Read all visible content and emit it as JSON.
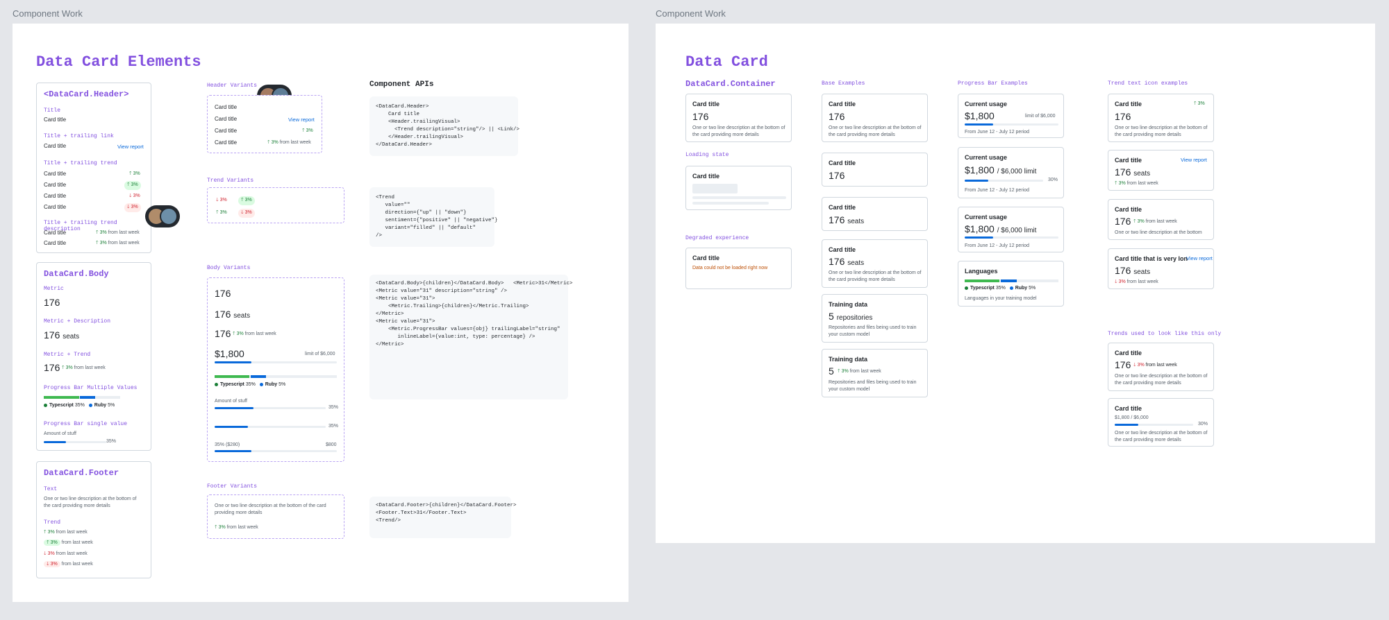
{
  "frames": {
    "left_label": "Component Work",
    "right_label": "Component Work"
  },
  "left": {
    "title": "Data Card Elements",
    "header_panel": {
      "title": "<DataCard.Header>",
      "s1": "Title",
      "s1_card": "Card title",
      "s2": "Title + trailing link",
      "s2_card": "Card title",
      "s2_link": "View report",
      "s3": "Title + trailing trend",
      "s3_rows": [
        {
          "label": "Card title",
          "trend": "3%"
        },
        {
          "label": "Card title",
          "trend": "3%"
        },
        {
          "label": "Card title",
          "trend": "3%"
        },
        {
          "label": "Card title",
          "trend": "3%"
        }
      ],
      "s4": "Title + trailing trend description",
      "s4_rows": [
        {
          "label": "Card title",
          "trend": "3%",
          "desc": "from last week"
        },
        {
          "label": "Card title",
          "trend": "3%",
          "desc": "from last week"
        }
      ]
    },
    "body_panel": {
      "title": "DataCard.Body",
      "s1": "Metric",
      "s1_value": "176",
      "s2": "Metric + Description",
      "s2_value": "176",
      "s2_unit": "seats",
      "s3": "Metric + Trend",
      "s3_value": "176",
      "s3_trend": "3%",
      "s3_desc": "from last week",
      "s4": "Progress Bar Multiple Values",
      "s4_legend": [
        {
          "name": "Typescript",
          "pct": "35%"
        },
        {
          "name": "Ruby",
          "pct": "5%"
        }
      ],
      "s5": "Progress Bar single value",
      "s5_label": "Amount of stuff",
      "s5_pct": "35%",
      "s5_fill": 0.35
    },
    "footer_panel": {
      "title": "DataCard.Footer",
      "s1": "Text",
      "s1_text": "One or two line description at the bottom of the card providing more details",
      "s2": "Trend",
      "trends": [
        {
          "value": "3%",
          "desc": "from last week"
        },
        {
          "value": "3%",
          "desc": "from last week"
        },
        {
          "value": "3%",
          "desc": "from last week"
        },
        {
          "value": "3%",
          "desc": "from last week"
        }
      ]
    },
    "header_variants": {
      "label": "Header Variants",
      "rows": [
        "Card title",
        "Card title",
        "Card title",
        "Card title"
      ],
      "link": "View report",
      "trend": "3%",
      "trend2": "3%",
      "trend2_desc": "from last week"
    },
    "trend_variants": {
      "label": "Trend Variants",
      "items": [
        "3%",
        "3%",
        "3%",
        "3%"
      ]
    },
    "body_variants": {
      "label": "Body Variants",
      "v1": "176",
      "v2": "176",
      "v2_unit": "seats",
      "v3": "176",
      "v3_trend": "3%",
      "v3_desc": "from last week",
      "v4": "$1,800",
      "v4_limit": "limit of $6,000",
      "v4_fill": 0.3,
      "legend": [
        {
          "name": "Typescript",
          "pct": "35%"
        },
        {
          "name": "Ruby",
          "pct": "5%"
        }
      ],
      "amount_label": "Amount of stuff",
      "amount_pct": "35%",
      "amount_fill": 0.35,
      "p2_pct": "35%",
      "p2_fill": 0.3,
      "p3_left": "35% ($280)",
      "p3_right": "$800",
      "p3_fill": 0.3
    },
    "footer_variants": {
      "label": "Footer Variants",
      "text": "One or two line description at the bottom of the card providing more details",
      "trend": "3%",
      "trend_desc": "from last week"
    },
    "apis": {
      "title": "Component APIs",
      "header_code": [
        "<DataCard.Header>",
        "    Card title",
        "    <Header.trailingVisual>",
        "      <Trend description=\"string\"/> || <Link/>",
        "    </Header.trailingVisual>",
        "</DataCard.Header>"
      ],
      "trend_code": [
        "<Trend",
        "   value=\"\"",
        "   direction={\"up\" || \"down\"}",
        "   sentiment={\"positive\" || \"negative\"}",
        "   variant=\"filled\" || \"default\"",
        "/>"
      ],
      "body_code": [
        "<DataCard.Body>{children}</DataCard.Body>   <Metric>31</Metric>",
        "",
        "",
        "<Metric value=\"31\" description=\"string\" />",
        "",
        "",
        "<Metric value=\"31\">",
        "    <Metric.Trailing>{children}</Metric.Trailing>",
        "</Metric>",
        "",
        "",
        "<Metric value=\"31\">",
        "    <Metric.ProgressBar values={obj} trailingLabel=\"string\"",
        "       inlineLabel={value:int, type: percentage} />",
        "</Metric>"
      ],
      "footer_code": [
        "<DataCard.Footer>{children}</DataCard.Footer>",
        "",
        "<Footer.Text>31</Footer.Text>",
        "",
        "<Trend/>"
      ]
    }
  },
  "right": {
    "title": "Data Card",
    "container": {
      "title": "DataCard.Container",
      "card_title": "Card title",
      "value": "176",
      "desc": "One or two line description at the bottom of the card providing more details",
      "loading_label": "Loading state",
      "loading_title": "Card title",
      "degraded_label": "Degraded experience",
      "degraded_title": "Card title",
      "degraded_msg": "Data could not be loaded right now"
    },
    "base": {
      "label": "Base Examples",
      "c1": {
        "title": "Card title",
        "value": "176",
        "desc": "One or two line description at the bottom of the card providing more details"
      },
      "c2": {
        "title": "Card title",
        "value": "176"
      },
      "c3": {
        "title": "Card title",
        "value": "176",
        "unit": "seats"
      },
      "c4": {
        "title": "Card title",
        "value": "176",
        "unit": "seats",
        "desc": "One or two line description at the bottom of the card providing more details"
      },
      "c5": {
        "title": "Training data",
        "value": "5",
        "unit": "repositories",
        "desc": "Repositories and files being used to train your custom model"
      },
      "c6": {
        "title": "Training data",
        "value": "5",
        "trend": "3%",
        "trend_desc": "from last week",
        "desc": "Repositories and files being used to train your custom model"
      }
    },
    "progress": {
      "label": "Progress Bar Examples",
      "c1": {
        "title": "Current usage",
        "value": "$1,800",
        "limit": "limit of $6,000",
        "fill": 0.3,
        "footer": "From June 12 - July 12 period"
      },
      "c2": {
        "title": "Current usage",
        "value": "$1,800",
        "sub": "/ $6,000 limit",
        "pct": "30%",
        "fill": 0.3,
        "footer": "From June 12 - July 12 period"
      },
      "c3": {
        "title": "Current usage",
        "value": "$1,800",
        "sub": "/ $6,000 limit",
        "fill": 0.3,
        "footer": "From June 12 - July 12 period"
      },
      "c4": {
        "title": "Languages",
        "legend": [
          {
            "name": "Typescript",
            "pct": "35%"
          },
          {
            "name": "Ruby",
            "pct": "5%"
          }
        ],
        "footer": "Languages in your training model"
      }
    },
    "trend_icons": {
      "label": "Trend text icon examples",
      "c1": {
        "title": "Card title",
        "trend": "3%",
        "value": "176",
        "desc": "One or two line description at the bottom of the card providing more details"
      },
      "c2": {
        "title": "Card title",
        "link": "View report",
        "value": "176",
        "unit": "seats",
        "trend": "3%",
        "trend_desc": "from last week"
      },
      "c3": {
        "title": "Card title",
        "value": "176",
        "trend": "3%",
        "trend_desc": "from last week",
        "desc": "One or two line description at the bottom"
      },
      "c4": {
        "title": "Card title that is very lon",
        "link": "View report",
        "value": "176",
        "unit": "seats",
        "trend": "3%",
        "trend_desc": "from last week"
      }
    },
    "old_trends": {
      "label": "Trends used to look like this only",
      "c1": {
        "title": "Card title",
        "value": "176",
        "trend": "3%",
        "trend_desc": "from last week",
        "desc": "One or two line description at the bottom of the card providing more details"
      },
      "c2": {
        "title": "Card title",
        "value": "$1,800 / $6,000",
        "pct": "30%",
        "fill": 0.3,
        "desc": "One or two line description at the bottom of the card providing more details"
      }
    }
  },
  "colors": {
    "accent": "#8250df",
    "up": "#1a7f37",
    "down": "#cf222e",
    "bar": "#0969da",
    "ts": "#3fb950",
    "ruby": "#0969da"
  }
}
